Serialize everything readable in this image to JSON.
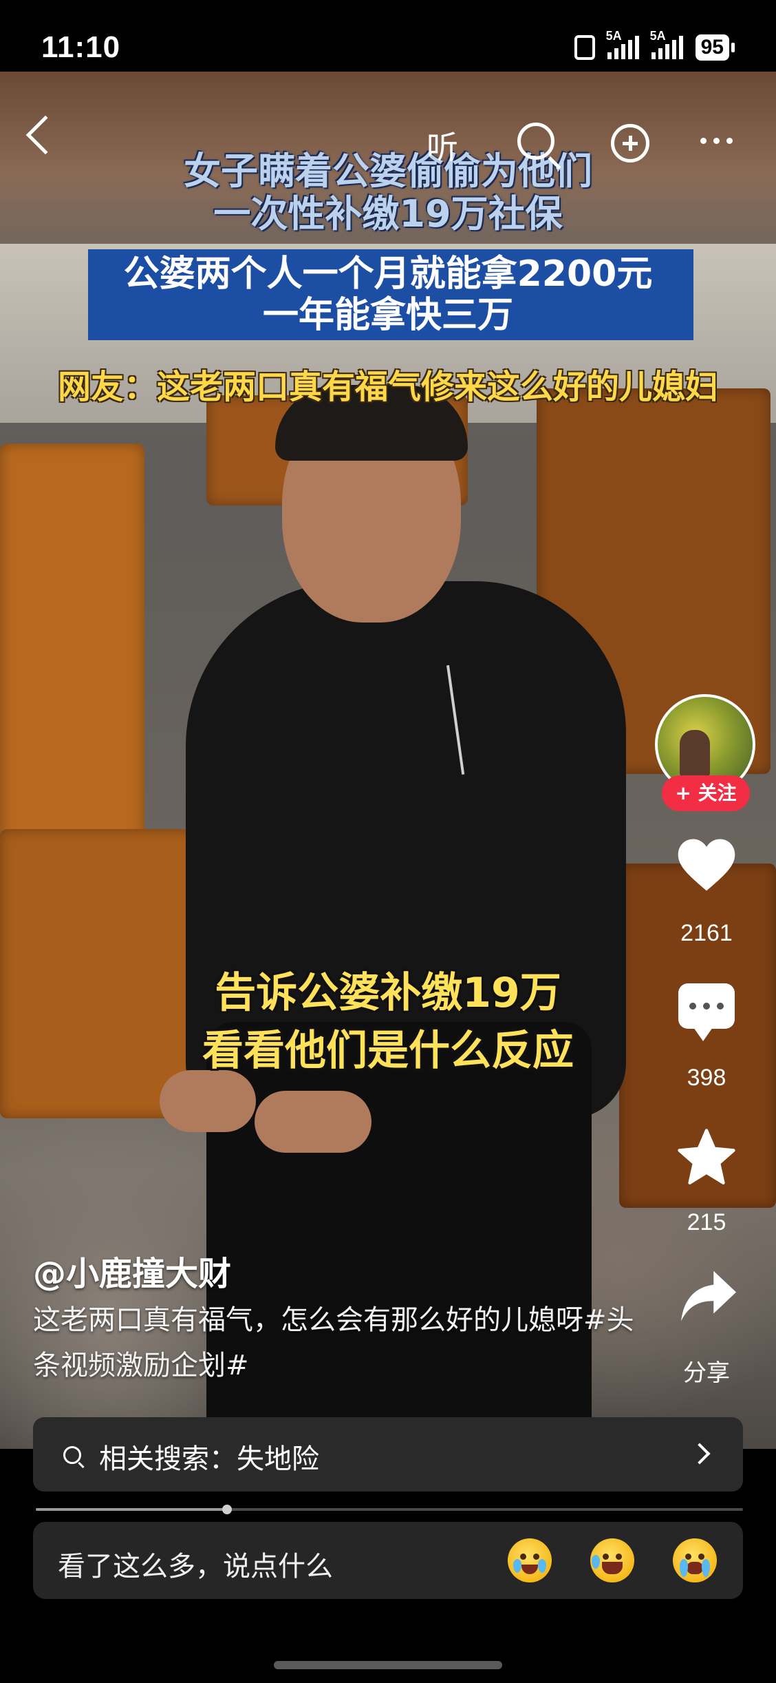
{
  "status_bar": {
    "time": "11:10",
    "network_1": "5A",
    "network_2": "5A",
    "battery": "95"
  },
  "top_nav": {
    "listen_label": "听"
  },
  "video_captions": {
    "title_line1": "女子瞒着公婆偷偷为他们",
    "title_line2": "一次性补缴19万社保",
    "blue_line1": "公婆两个人一个月就能拿2200元",
    "blue_line2": "一年能拿快三万",
    "netizen_line": "网友：这老两口真有福气修来这么好的儿媳妇",
    "middle_line1": "告诉公婆补缴19万",
    "middle_line2": "看看他们是什么反应"
  },
  "actions": {
    "follow_label": "+ 关注",
    "likes": "2161",
    "comments": "398",
    "favorites": "215",
    "share_label": "分享"
  },
  "post": {
    "author": "@小鹿撞大财",
    "description": "这老两口真有福气，怎么会有那么好的儿媳呀#头条视频激励企划#"
  },
  "related_search": {
    "text": "相关搜索：失地险"
  },
  "progress": {
    "fraction": 0.27
  },
  "comment_bar": {
    "placeholder": "看了这么多，说点什么"
  },
  "icons": [
    "back-icon",
    "search-icon",
    "add-icon",
    "more-icon",
    "heart-icon",
    "comment-icon",
    "star-icon",
    "share-icon",
    "chevron-right-icon"
  ],
  "colors": {
    "follow_button": "#f22e45",
    "caption_yellow": "#ffd84a",
    "caption_blue_box": "#1c4ea3"
  }
}
